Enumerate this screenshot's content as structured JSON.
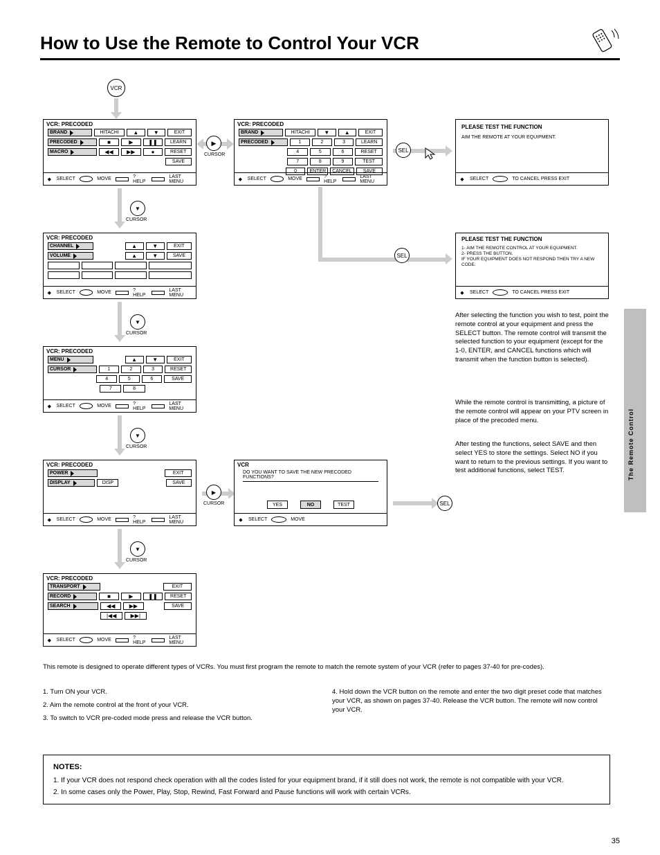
{
  "header": {
    "title": "How to Use the Remote to Control Your VCR"
  },
  "side_label": "The Remote Control",
  "page_number": "35",
  "circles": {
    "vcr": "VCR",
    "cursor_dn": "CURSOR",
    "cursor_rt": "CURSOR",
    "select": "SEL"
  },
  "circle_sub": {
    "down": "▼",
    "right": "▶"
  },
  "screens": {
    "s1": {
      "title": "VCR: PRECODED",
      "r1c1": "BRAND",
      "r1c2": "HITACHI",
      "up": "▲",
      "dn": "▼",
      "exit": "EXIT",
      "r2c1": "PRECODED",
      "stop": "■",
      "play": "▶",
      "pause": "❚❚",
      "learn": "LEARN",
      "r3c1": "MACRO",
      "rew": "◀◀",
      "ff": "▶▶",
      "rec": "●",
      "reset": "RESET",
      "save": "SAVE",
      "foot_sel": "SELECT",
      "foot_move": "MOVE",
      "foot_help": "? HELP",
      "foot_prev": "LAST MENU"
    },
    "s2": {
      "title": "VCR: PRECODED",
      "r1c1": "BRAND",
      "r1c2": "HITACHI",
      "dn": "▼",
      "up": "▲",
      "exit": "EXIT",
      "r2c1": "PRECODED",
      "c1": "1",
      "c2": "2",
      "c3": "3",
      "learn": "LEARN",
      "c4": "4",
      "c5": "5",
      "c6": "6",
      "reset": "RESET",
      "c7": "7",
      "c8": "8",
      "c9": "9",
      "test": "TEST",
      "c0": "0",
      "enter": "ENTER",
      "cancel": "CANCEL",
      "save": "SAVE"
    },
    "s3": {
      "title": "PLEASE TEST THE FUNCTION",
      "msg": "AIM THE REMOTE AT YOUR EQUIPMENT.",
      "foot": "TO CANCEL PRESS EXIT"
    },
    "s4": {
      "title": "PLEASE TEST THE FUNCTION",
      "line1": "1- AIM THE REMOTE CONTROL AT YOUR EQUIPMENT.",
      "line2": "2- PRESS THE BUTTON.",
      "line3": "IF YOUR EQUIPMENT DOES NOT RESPOND THEN TRY A NEW CODE.",
      "foot": "TO CANCEL PRESS EXIT"
    },
    "s5": {
      "title": "VCR: PRECODED",
      "r1c1": "CHANNEL",
      "up": "▲",
      "dn": "▼",
      "exit": "EXIT",
      "r2c1": "VOLUME",
      "vup": "▲",
      "vdn": "▼",
      "save": "SAVE"
    },
    "s6": {
      "title": "VCR: PRECODED",
      "r1c1": "MENU",
      "up": "▲",
      "dn": "▼",
      "exit": "EXIT",
      "r2c1": "CURSOR",
      "c1": "1",
      "c2": "2",
      "c3": "3",
      "reset": "RESET",
      "c4": "4",
      "c5": "5",
      "c6": "6",
      "save": "SAVE",
      "c7": "7",
      "c8": "8"
    },
    "s7": {
      "title": "VCR: PRECODED",
      "r1c1": "POWER",
      "exit": "EXIT",
      "r2c1": "DISPLAY",
      "disp": "DISP",
      "save": "SAVE"
    },
    "s8": {
      "title": "VCR",
      "msg": "DO YOU WANT TO SAVE THE NEW PRECODED FUNCTIONS?",
      "yes": "YES",
      "no": "NO",
      "test": "TEST",
      "foot_sel": "SELECT",
      "foot_move": "MOVE"
    },
    "s9": {
      "title": "VCR: PRECODED",
      "r1c1": "TRANSPORT",
      "exit": "EXIT",
      "r2c1": "RECORD",
      "stop": "■",
      "play": "▶",
      "pause": "❚❚",
      "reset": "RESET",
      "r3c1": "SEARCH",
      "rew": "◀◀",
      "ff": "▶▶",
      "save": "SAVE",
      "sk1": "|◀◀",
      "sk2": "▶▶|"
    }
  },
  "body_text": {
    "p1": "After selecting the function you wish to test, point the remote control at your equipment and press the SELECT button. The remote control will transmit the selected function to your equipment (except for the 1-0, ENTER, and CANCEL functions which will transmit when the function button is selected).",
    "p2": "While the remote control is transmitting, a picture of the remote control will appear on your PTV screen in place of the precoded menu.",
    "p3": "After testing the functions, select SAVE and then select YES to store the settings. Select NO if you want to return to the previous settings. If you want to test additional functions, select TEST.",
    "p4": "This remote is designed to operate different types of VCRs. You must first program the remote to match the remote system of your VCR (refer to pages 37-40 for pre-codes)."
  },
  "steps": {
    "s1": "1. Turn ON your VCR.",
    "s2": "2. Aim the remote control at the front of your VCR.",
    "s3": "3. To switch to VCR pre-coded mode press and release the VCR button.",
    "s4": "4. Hold down the VCR button on the remote and enter the two digit preset code that matches your VCR, as shown on pages 37-40. Release the VCR button. The remote will now control your VCR."
  },
  "notes": {
    "title": "NOTES:",
    "n1": "1. If your VCR does not respond check operation with all the codes listed for your equipment brand, if it still does not work, the remote is not compatible with your VCR.",
    "n2": "2. In some cases only the Power, Play, Stop, Rewind, Fast Forward and Pause functions will work with certain VCRs."
  }
}
